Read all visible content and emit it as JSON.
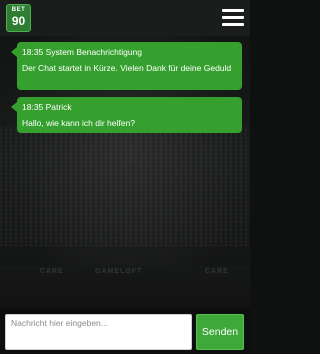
{
  "header": {
    "logo_top": "BET",
    "logo_bottom": "90"
  },
  "background": {
    "banner_left": "CARE",
    "banner_mid": "GAMELOFT",
    "banner_right": "CARE"
  },
  "messages": [
    {
      "time": "18:35",
      "sender": "System Benachrichtigung",
      "meta": "18:35 System Benachrichtigung",
      "text": "Der Chat startet in Kürze. Vielen Dank für deine Geduld"
    },
    {
      "time": "18:35",
      "sender": "Patrick",
      "meta": "18:35 Patrick",
      "text": "Hallo, wie kann ich dir helfen?"
    }
  ],
  "composer": {
    "placeholder": "Nachricht hier eingeben...",
    "value": "",
    "send_label": "Senden"
  },
  "colors": {
    "bubble": "#36a02f",
    "send_button": "#3ea83a",
    "header": "#1b1d1c",
    "logo": "#2e7d32"
  }
}
